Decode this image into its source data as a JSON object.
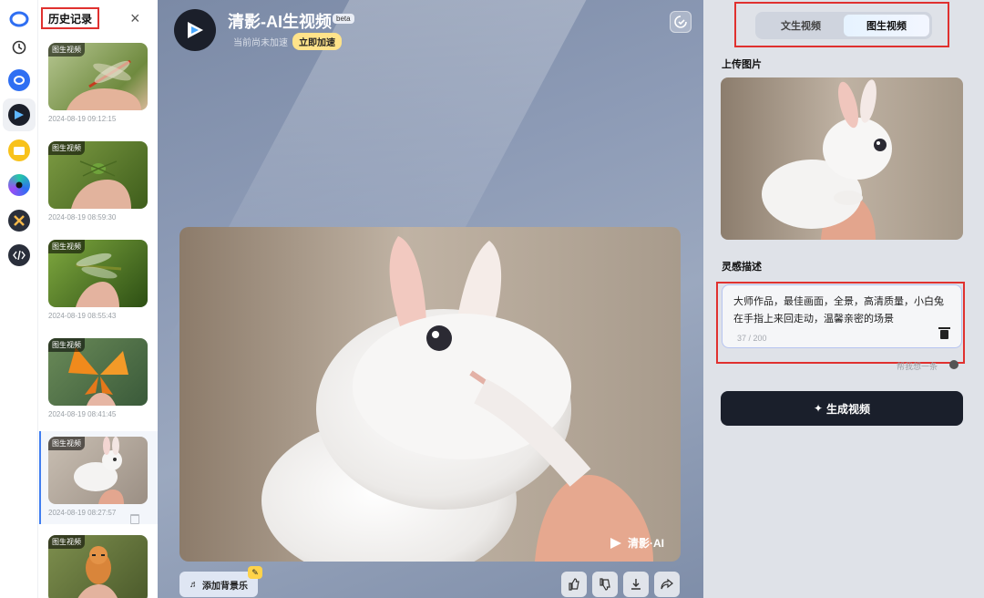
{
  "rail": {
    "icons": [
      "logo-icon",
      "history-icon",
      "app-icon-1",
      "video-app-icon",
      "folder-icon",
      "circle-app-icon",
      "x-app-icon",
      "code-icon"
    ]
  },
  "history": {
    "title": "历史记录",
    "close": "×",
    "items": [
      {
        "tag": "图生视频",
        "time": "2024-08-19 09:12:15"
      },
      {
        "tag": "图生视频",
        "time": "2024-08-19 08:59:30"
      },
      {
        "tag": "图生视频",
        "time": "2024-08-19 08:55:43"
      },
      {
        "tag": "图生视频",
        "time": "2024-08-19 08:41:45"
      },
      {
        "tag": "图生视频",
        "time": "2024-08-19 08:27:57"
      },
      {
        "tag": "图生视频",
        "time": ""
      }
    ]
  },
  "header": {
    "title": "清影-AI生视频",
    "beta": "beta",
    "subtitle": "当前尚未加速",
    "speed_button": "立即加速"
  },
  "video": {
    "watermark": "清影·AI"
  },
  "toolbar": {
    "music_button": "添加背景乐"
  },
  "panel": {
    "tabs": [
      "文生视频",
      "图生视频"
    ],
    "active_tab": "图生视频",
    "upload_label": "上传图片",
    "prompt_label": "灵感描述",
    "prompt_text": "大师作品，最佳画面，全景，高清质量，小白兔在手指上来回走动，温馨亲密的场景",
    "counter": "37 / 200",
    "help": "帮我想一条",
    "generate_button": "生成视频"
  },
  "colors": {
    "accent": "#3f7df0",
    "highlight_box": "#e0312f",
    "button_dark": "#1a1f2b"
  }
}
